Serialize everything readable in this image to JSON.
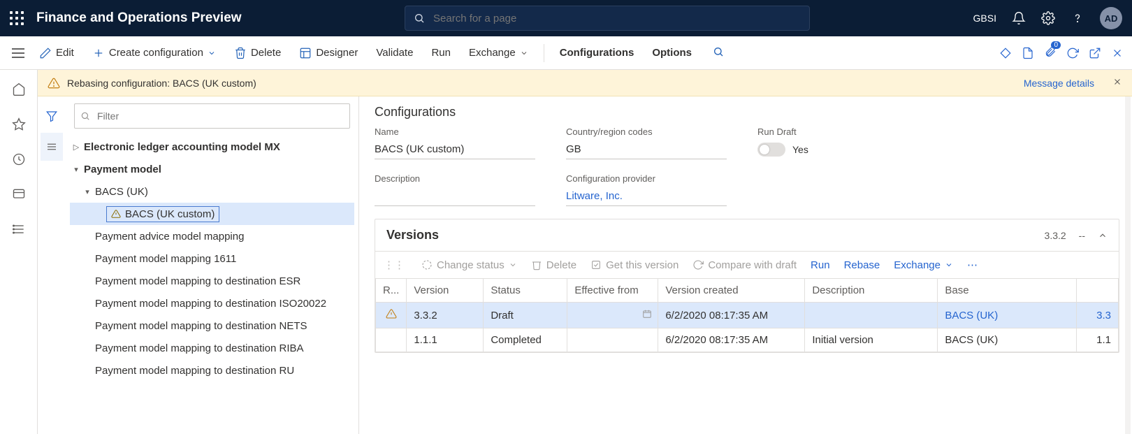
{
  "app_title": "Finance and Operations Preview",
  "search_placeholder": "Search for a page",
  "company": "GBSI",
  "avatar": "AD",
  "command_bar": {
    "edit": "Edit",
    "create": "Create configuration",
    "delete": "Delete",
    "designer": "Designer",
    "validate": "Validate",
    "run": "Run",
    "exchange": "Exchange",
    "configs": "Configurations",
    "options": "Options",
    "attach_badge": "0"
  },
  "message_bar": {
    "text": "Rebasing configuration: BACS (UK custom)",
    "link": "Message details"
  },
  "filter_placeholder": "Filter",
  "tree": {
    "n0": "Electronic ledger accounting model MX",
    "n1": "Payment model",
    "n2": "BACS (UK)",
    "n3": "BACS (UK custom)",
    "n4": "Payment advice model mapping",
    "n5": "Payment model mapping 1611",
    "n6": "Payment model mapping to destination ESR",
    "n7": "Payment model mapping to destination ISO20022",
    "n8": "Payment model mapping to destination NETS",
    "n9": "Payment model mapping to destination RIBA",
    "n10": "Payment model mapping to destination RU"
  },
  "details": {
    "section": "Configurations",
    "labels": {
      "name": "Name",
      "country": "Country/region codes",
      "run_draft": "Run Draft",
      "description": "Description",
      "provider": "Configuration provider"
    },
    "values": {
      "name": "BACS (UK custom)",
      "country": "GB",
      "run_draft": "Yes",
      "provider": "Litware, Inc."
    }
  },
  "versions": {
    "title": "Versions",
    "current": "3.3.2",
    "dash": "--",
    "tools": {
      "change_status": "Change status",
      "delete": "Delete",
      "get_this": "Get this version",
      "compare": "Compare with draft",
      "run": "Run",
      "rebase": "Rebase",
      "exchange": "Exchange"
    },
    "headers": {
      "reb": "R...",
      "version": "Version",
      "status": "Status",
      "effective": "Effective from",
      "created": "Version created",
      "description": "Description",
      "base": "Base",
      "basev": ""
    },
    "rows": [
      {
        "warn": true,
        "version": "3.3.2",
        "status": "Draft",
        "effective": "",
        "created": "6/2/2020 08:17:35 AM",
        "description": "",
        "base": "BACS (UK)",
        "basev": "3.3",
        "base_link": true
      },
      {
        "warn": false,
        "version": "1.1.1",
        "status": "Completed",
        "effective": "",
        "created": "6/2/2020 08:17:35 AM",
        "description": "Initial version",
        "base": "BACS (UK)",
        "basev": "1.1",
        "base_link": false
      }
    ]
  }
}
